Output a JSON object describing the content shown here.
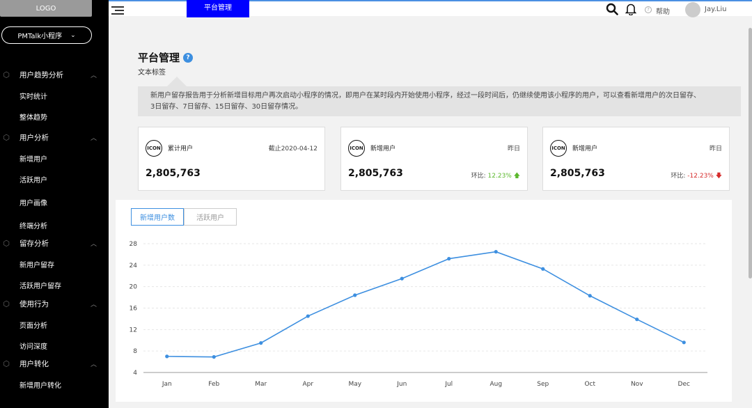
{
  "sidebar": {
    "logo": "LOGO",
    "app_select": "PMTalk小程序",
    "groups": [
      {
        "label": "用户趋势分析",
        "items": [
          "实时统计",
          "整体趋势"
        ]
      },
      {
        "label": "用户分析",
        "items": [
          "新增用户",
          "活跃用户",
          "用户画像",
          "终端分析"
        ]
      },
      {
        "label": "留存分析",
        "items": [
          "新用户留存",
          "活跃用户留存"
        ]
      },
      {
        "label": "使用行为",
        "items": [
          "页面分析",
          "访问深度"
        ]
      },
      {
        "label": "用户转化",
        "items": [
          "新增用户转化"
        ]
      }
    ]
  },
  "header": {
    "active_tab": "平台管理",
    "help": "帮助",
    "user": "Jay.Liu"
  },
  "page": {
    "title": "平台管理",
    "subtitle": "文本标签",
    "description_line1": "新用户留存报告用于分析新增目标用户再次启动小程序的情况，即用户在某时段内开始使用小程序，经过一段时间后，仍继续使用该小程序的用户，可以查看新增用户的次日留存、",
    "description_line2": "3日留存、7日留存、15日留存、30日留存情况。"
  },
  "cards": [
    {
      "icon": "ICON",
      "label": "累计用户",
      "date": "截止2020-04-12",
      "value": "2,805,763"
    },
    {
      "icon": "ICON",
      "label": "新增用户",
      "date": "昨日",
      "value": "2,805,763",
      "ratio_label": "环比:",
      "ratio_value": "12.23%",
      "trend": "up"
    },
    {
      "icon": "ICON",
      "label": "新增用户",
      "date": "昨日",
      "value": "2,805,763",
      "ratio_label": "环比:",
      "ratio_value": "-12.23%",
      "trend": "down"
    }
  ],
  "chart_tabs": [
    "新增用户数",
    "活跃用户"
  ],
  "colors": {
    "accent": "#3d8fe0",
    "up": "#5cb82e",
    "down": "#d62b2b",
    "header_tab": "#0000ff"
  },
  "chart_data": {
    "type": "line",
    "categories": [
      "Jan",
      "Feb",
      "Mar",
      "Apr",
      "May",
      "Jun",
      "Jul",
      "Aug",
      "Sep",
      "Oct",
      "Nov",
      "Dec"
    ],
    "series": [
      {
        "values": [
          7.0,
          6.9,
          9.5,
          14.5,
          18.4,
          21.5,
          25.2,
          26.5,
          23.3,
          18.3,
          13.9,
          9.6
        ]
      }
    ],
    "yticks": [
      4,
      8,
      12,
      16,
      20,
      24,
      28
    ],
    "ylim": [
      4,
      28
    ],
    "grid": true,
    "title": "",
    "xlabel": "",
    "ylabel": ""
  }
}
